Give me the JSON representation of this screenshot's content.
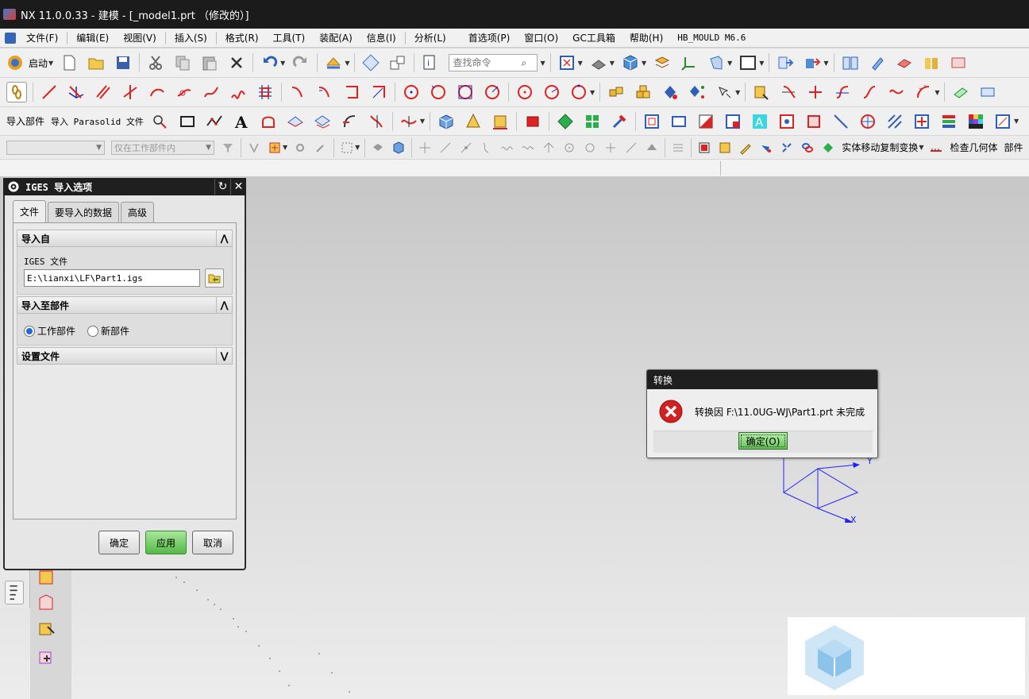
{
  "window": {
    "title": "NX 11.0.0.33 - 建模 - [_model1.prt （修改的）]"
  },
  "menubar": {
    "items": [
      "文件(F)",
      "编辑(E)",
      "视图(V)",
      "插入(S)",
      "格式(R)",
      "工具(T)",
      "装配(A)",
      "信息(I)",
      "分析(L)",
      "首选项(P)",
      "窗口(O)",
      "GC工具箱",
      "帮助(H)",
      "HB_MOULD M6.6"
    ]
  },
  "toolbar1": {
    "start_label": "启动",
    "search_placeholder": "查找命令"
  },
  "toolbar3": {
    "import_part": "导入部件",
    "import_parasolid": "导入 Parasolid 文件"
  },
  "toolbar4": {
    "filter_placeholder": "",
    "scope_placeholder": "仅在工作部件内",
    "move_copy_label": "实体移动复制变换",
    "check_geometry_label": "检查几何体",
    "part_label": "部件"
  },
  "iges_dialog": {
    "title": "IGES 导入选项",
    "tabs": [
      "文件",
      "要导入的数据",
      "高级"
    ],
    "group_import_from": "导入自",
    "iges_file_label": "IGES 文件",
    "iges_file_path": "E:\\lianxi\\LF\\Part1.igs",
    "group_import_to": "导入至部件",
    "radio_work_part": "工作部件",
    "radio_new_part": "新部件",
    "group_settings": "设置文件",
    "btn_ok": "确定",
    "btn_apply": "应用",
    "btn_cancel": "取消"
  },
  "message_dialog": {
    "title": "转换",
    "text": "转换因 F:\\11.0UG-WJ\\Part1.prt 未完成",
    "ok": "确定(O)"
  },
  "triad": {
    "x_label": "X",
    "y_label": "Y"
  },
  "colors": {
    "titlebar": "#1b1b1b",
    "apply_green": "#54b946",
    "error_red": "#d42020",
    "triad_blue": "#2020ff"
  }
}
